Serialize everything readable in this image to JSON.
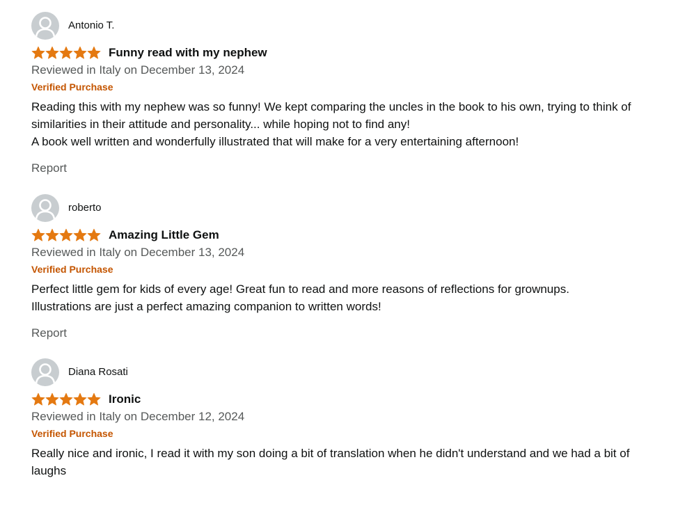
{
  "colors": {
    "star": "#e47911",
    "verified": "#c45500",
    "muted": "#565959",
    "text": "#0f1111",
    "avatar_bg": "#c8cdd0"
  },
  "reviews": [
    {
      "reviewer": "Antonio T.",
      "avatar_icon": "default-profile-icon",
      "rating": 5,
      "rating_max": 5,
      "title": "Funny read with my nephew",
      "date": "Reviewed in Italy on December 13, 2024",
      "verified": "Verified Purchase",
      "body": [
        "Reading this with my nephew was so funny! We kept comparing the uncles in the book to his own, trying to think of similarities in their attitude and personality... while hoping not to find any!",
        "A book well written and wonderfully illustrated that will make for a very entertaining afternoon!"
      ],
      "report": "Report"
    },
    {
      "reviewer": "roberto",
      "avatar_icon": "default-profile-icon",
      "rating": 5,
      "rating_max": 5,
      "title": "Amazing Little Gem",
      "date": "Reviewed in Italy on December 13, 2024",
      "verified": "Verified Purchase",
      "body": [
        "Perfect little gem for kids of every age! Great fun to read and more reasons of reflections for grownups.",
        "Illustrations are just a perfect amazing companion to written words!"
      ],
      "report": "Report"
    },
    {
      "reviewer": "Diana Rosati",
      "avatar_icon": "default-profile-icon",
      "rating": 5,
      "rating_max": 5,
      "title": "Ironic",
      "date": "Reviewed in Italy on December 12, 2024",
      "verified": "Verified Purchase",
      "body": [
        "Really nice and ironic, I read it with my son doing a bit of translation when he didn't understand and we had a bit of laughs"
      ]
    }
  ]
}
